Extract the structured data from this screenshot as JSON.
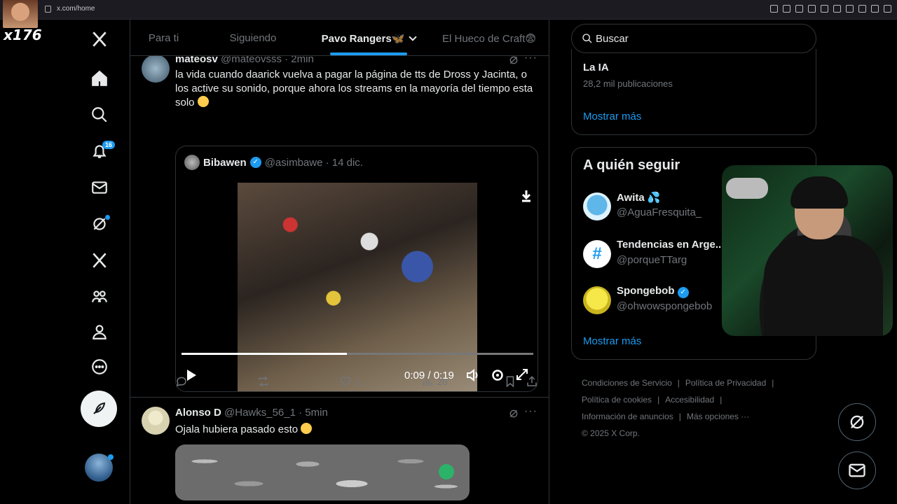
{
  "browser": {
    "url": "x.com/home"
  },
  "overlay": {
    "stream_tag": "x176"
  },
  "nav": {
    "notifications_count": "16"
  },
  "tabs": [
    {
      "label": "Para ti",
      "active": false
    },
    {
      "label": "Siguiendo",
      "active": false
    },
    {
      "label": "Pavo Rangers🦋",
      "active": true
    },
    {
      "label": "El Hueco de Craft😨",
      "active": false
    }
  ],
  "tweet1": {
    "name": "mateosv",
    "handle": "@mateovsss · 2min",
    "text": "la vida cuando daarick vuelva a pagar la página de tts de Dross y Jacinta, o los active su sonido, porque ahora los streams en la mayoría del tiempo esta solo",
    "quote": {
      "name": "Bibawen",
      "handle": "@asimbawe · 14 dic.",
      "video_time": "0:09 / 0:19",
      "progress": 0.47
    },
    "actions": {
      "replies": "",
      "reposts": "",
      "likes": "1",
      "views": "20"
    }
  },
  "tweet2": {
    "name": "Alonso D",
    "handle": "@Hawks_56_1 · 5min",
    "text": "Ojala hubiera pasado esto"
  },
  "right": {
    "search_placeholder": "Buscar",
    "trend": {
      "name": "La IA",
      "count": "28,2 mil publicaciones",
      "show_more": "Mostrar más"
    },
    "who_to_follow": {
      "title": "A quién seguir",
      "accounts": [
        {
          "name": "Awita 💦",
          "handle": "@AguaFresquita_"
        },
        {
          "name": "Tendencias en Arge...",
          "handle": "@porqueTTarg"
        },
        {
          "name": "Spongebob",
          "handle": "@ohwowspongebob"
        }
      ],
      "show_more": "Mostrar más"
    },
    "footer": {
      "terms": "Condiciones de Servicio",
      "privacy": "Política de Privacidad",
      "cookies": "Política de cookies",
      "accessibility": "Accesibilidad",
      "ads": "Información de anuncios",
      "more": "Más opciones ···",
      "copyright": "© 2025 X Corp."
    }
  }
}
